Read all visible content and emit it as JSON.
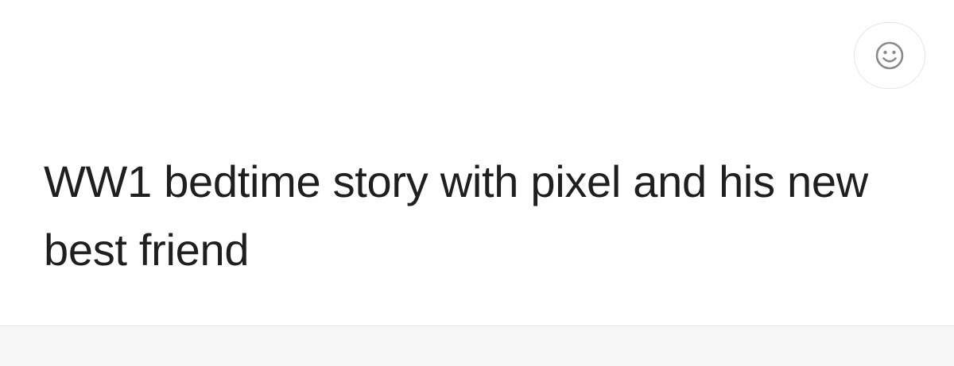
{
  "message": {
    "text": "WW1 bedtime story with pixel and his new best friend"
  },
  "actions": {
    "reaction_icon": "smiley-face-icon"
  },
  "colors": {
    "text": "#1f1f1f",
    "icon": "#8a8a8a",
    "button_border": "#e6e6e6",
    "background": "#ffffff",
    "bottom_bar": "#f6f6f6"
  }
}
